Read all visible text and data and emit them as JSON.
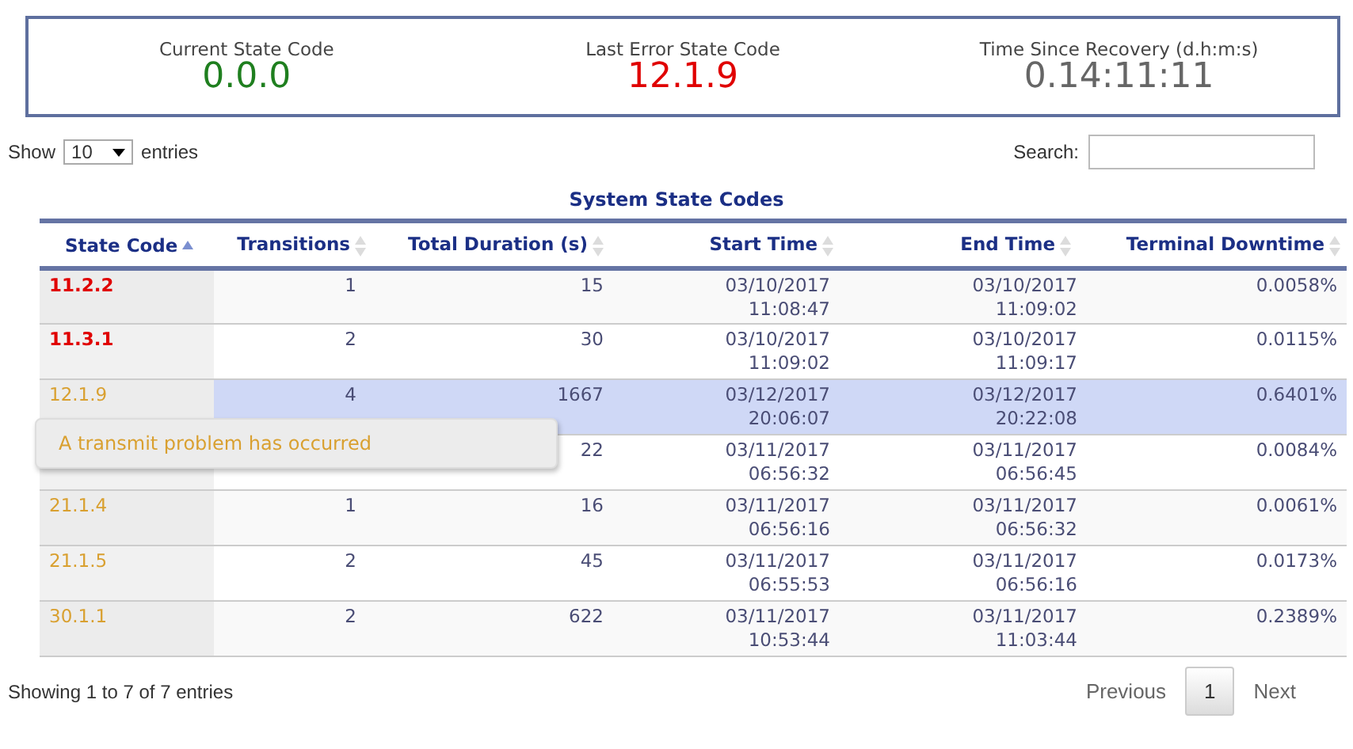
{
  "summary": [
    {
      "label": "Current State Code",
      "value": "0.0.0",
      "kind": "ok"
    },
    {
      "label": "Last Error State Code",
      "value": "12.1.9",
      "kind": "error"
    },
    {
      "label": "Time Since Recovery (d.h:m:s)",
      "value": "0.14:11:11",
      "kind": "neutral"
    }
  ],
  "length_control": {
    "show": "Show",
    "value": "10",
    "entries": "entries"
  },
  "search": {
    "label": "Search:"
  },
  "table": {
    "caption": "System State Codes",
    "columns": [
      {
        "label": "State Code",
        "sorted": true
      },
      {
        "label": "Transitions",
        "sorted": false
      },
      {
        "label": "Total Duration (s)",
        "sorted": false
      },
      {
        "label": "Start Time",
        "sorted": false
      },
      {
        "label": "End Time",
        "sorted": false
      },
      {
        "label": "Terminal Downtime",
        "sorted": false
      }
    ],
    "rows": [
      {
        "code": "11.2.2",
        "kind": "error",
        "selected": false,
        "transitions": "1",
        "duration": "15",
        "start": [
          "03/10/2017",
          "11:08:47"
        ],
        "end": [
          "03/10/2017",
          "11:09:02"
        ],
        "downtime": "0.0058%"
      },
      {
        "code": "11.3.1",
        "kind": "error",
        "selected": false,
        "transitions": "2",
        "duration": "30",
        "start": [
          "03/10/2017",
          "11:09:02"
        ],
        "end": [
          "03/10/2017",
          "11:09:17"
        ],
        "downtime": "0.0115%"
      },
      {
        "code": "12.1.9",
        "kind": "warning",
        "selected": true,
        "transitions": "4",
        "duration": "1667",
        "start": [
          "03/12/2017",
          "20:06:07"
        ],
        "end": [
          "03/12/2017",
          "20:22:08"
        ],
        "downtime": "0.6401%"
      },
      {
        "code": "",
        "selected": false,
        "transitions": "",
        "duration": "22",
        "start": [
          "03/11/2017",
          "06:56:32"
        ],
        "end": [
          "03/11/2017",
          "06:56:45"
        ],
        "downtime": "0.0084%"
      },
      {
        "code": "21.1.4",
        "kind": "warning",
        "selected": false,
        "transitions": "1",
        "duration": "16",
        "start": [
          "03/11/2017",
          "06:56:16"
        ],
        "end": [
          "03/11/2017",
          "06:56:32"
        ],
        "downtime": "0.0061%"
      },
      {
        "code": "21.1.5",
        "kind": "warning",
        "selected": false,
        "transitions": "2",
        "duration": "45",
        "start": [
          "03/11/2017",
          "06:55:53"
        ],
        "end": [
          "03/11/2017",
          "06:56:16"
        ],
        "downtime": "0.0173%"
      },
      {
        "code": "30.1.1",
        "kind": "warning",
        "selected": false,
        "transitions": "2",
        "duration": "622",
        "start": [
          "03/11/2017",
          "10:53:44"
        ],
        "end": [
          "03/11/2017",
          "11:03:44"
        ],
        "downtime": "0.2389%"
      }
    ]
  },
  "tooltip": {
    "text": "A transmit problem has occurred"
  },
  "footer": {
    "info": "Showing 1 to 7 of 7 entries",
    "pagination": [
      {
        "label": "Previous",
        "selected": false
      },
      {
        "label": "1",
        "selected": true
      },
      {
        "label": "Next",
        "selected": false
      }
    ]
  }
}
